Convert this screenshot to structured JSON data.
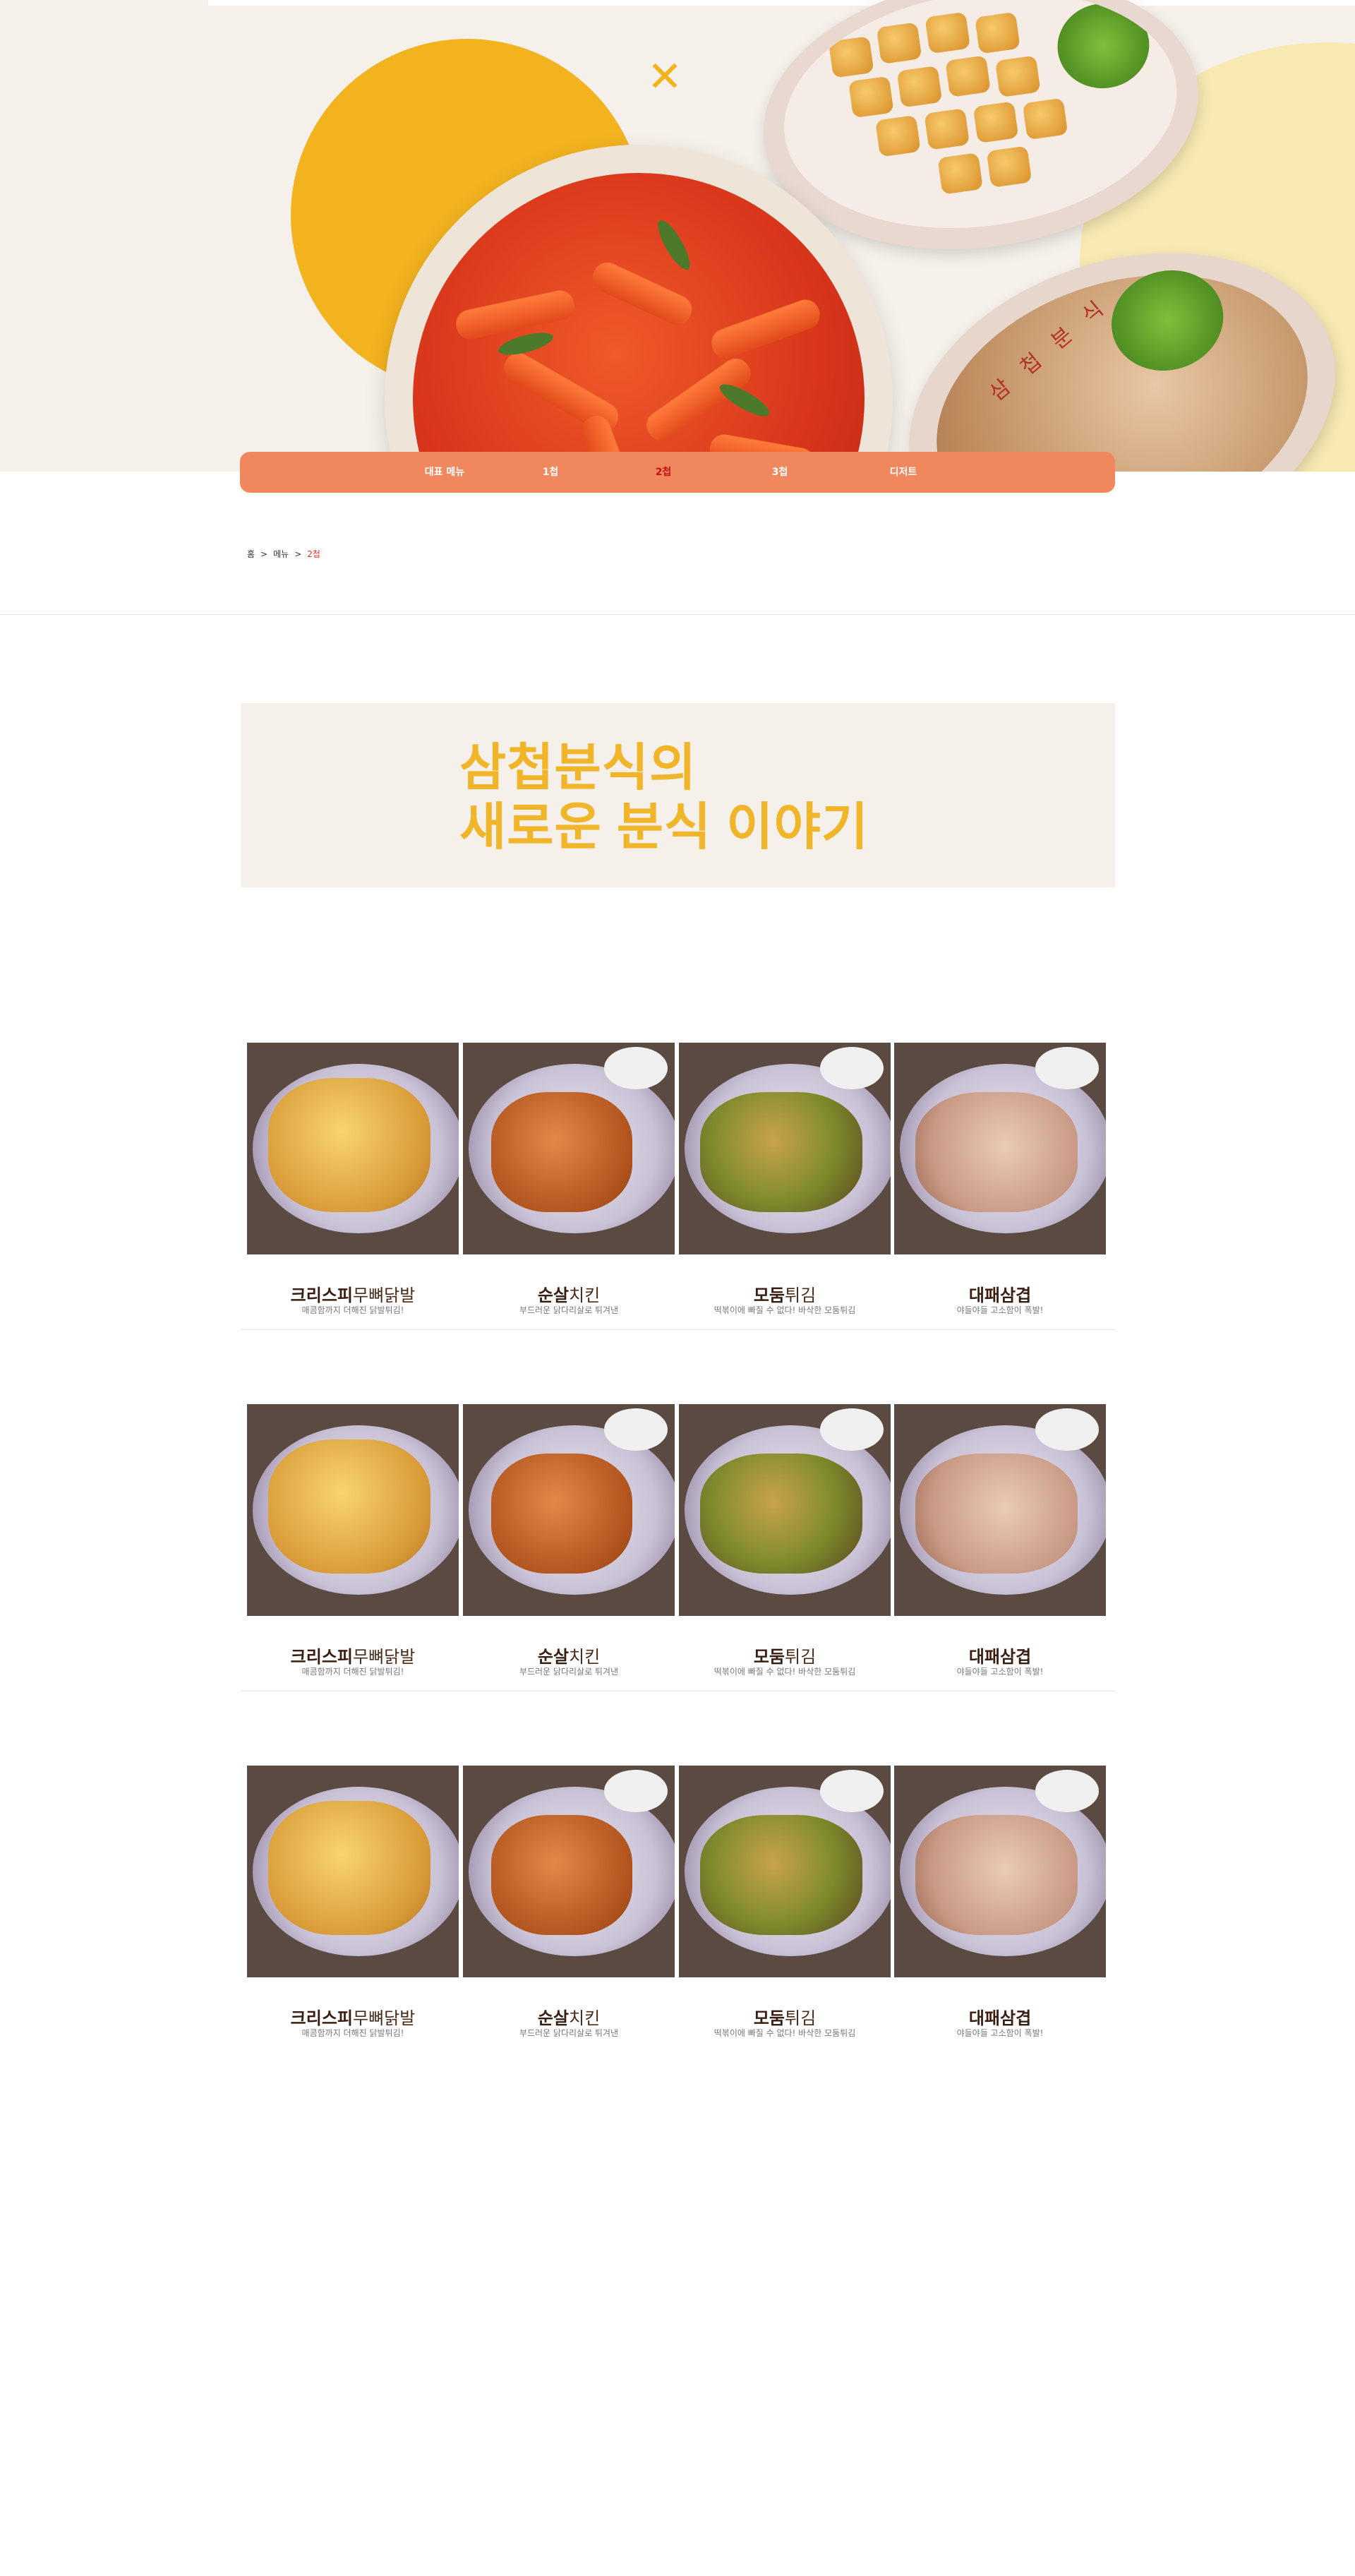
{
  "hero": {
    "plate_text": "삼 첩 분 식"
  },
  "nav": {
    "items": [
      {
        "label": "대표 메뉴"
      },
      {
        "label": "1첩"
      },
      {
        "label": "2첩"
      },
      {
        "label": "3첩"
      },
      {
        "label": "디저트"
      }
    ],
    "active_index": 2
  },
  "breadcrumb": {
    "items": [
      "홈",
      ">",
      "메뉴",
      ">",
      "2첩"
    ]
  },
  "banner": {
    "title": "삼첩분식의\n새로운 분식 이야기"
  },
  "menu_rows": [
    {
      "items": [
        {
          "name_bold": "크리스피",
          "name_light": "무뼈닭발",
          "desc": "매콤함까지 더해진 닭발튀김!"
        },
        {
          "name_bold": "순살",
          "name_light": "치킨",
          "desc": "부드러운 닭다리살로 튀겨낸"
        },
        {
          "name_bold": "모둠",
          "name_light": "튀김",
          "desc": "떡볶이에 빠질 수 없다! 바삭한 모둠튀김"
        },
        {
          "name_bold": "대패삼겹",
          "name_light": "",
          "desc": "야들야들 고소함이 폭발!"
        }
      ]
    },
    {
      "items": [
        {
          "name_bold": "크리스피",
          "name_light": "무뼈닭발",
          "desc": "매콤함까지 더해진 닭발튀김!"
        },
        {
          "name_bold": "순살",
          "name_light": "치킨",
          "desc": "부드러운 닭다리살로 튀겨낸"
        },
        {
          "name_bold": "모둠",
          "name_light": "튀김",
          "desc": "떡볶이에 빠질 수 없다! 바삭한 모둠튀김"
        },
        {
          "name_bold": "대패삼겹",
          "name_light": "",
          "desc": "야들야들 고소함이 폭발!"
        }
      ]
    },
    {
      "items": [
        {
          "name_bold": "크리스피",
          "name_light": "무뼈닭발",
          "desc": "매콤함까지 더해진 닭발튀김!"
        },
        {
          "name_bold": "순살",
          "name_light": "치킨",
          "desc": "부드러운 닭다리살로 튀겨낸"
        },
        {
          "name_bold": "모둠",
          "name_light": "튀김",
          "desc": "떡볶이에 빠질 수 없다! 바삭한 모둠튀김"
        },
        {
          "name_bold": "대패삼겹",
          "name_light": "",
          "desc": "야들야들 고소함이 폭발!"
        }
      ]
    }
  ],
  "colors": {
    "nav_bg": "#f0875d",
    "nav_active": "#c4121a",
    "banner_text": "#f1b52a",
    "hero_bg": "#f5f1ea"
  }
}
